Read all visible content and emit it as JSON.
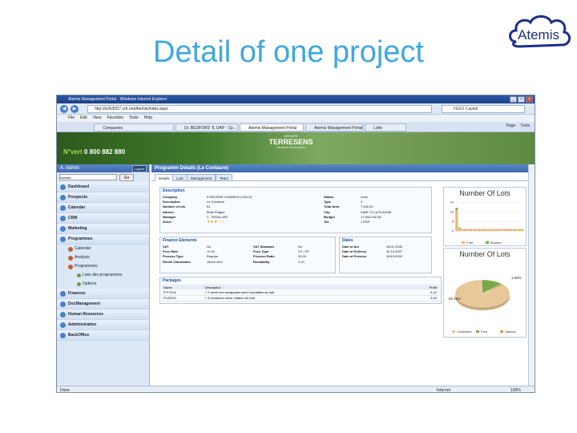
{
  "slide": {
    "title": "Detail of one project",
    "logo_text": "Atemis"
  },
  "browser": {
    "window_title": "Atemis Management Portal - Windows Internet Explorer",
    "url": "http://w2k3IIS7.rzh.net/Atemis/index.aspx",
    "search_placeholder": "FEED Capital",
    "menu": [
      "File",
      "Edit",
      "View",
      "Favorites",
      "Tools",
      "Help"
    ],
    "tabs": [
      "Companies",
      "Dr. BEDFORD 'IL DAP - Cp...",
      "Atemis Management Portal",
      "Atemis Management Portal",
      "Lotto"
    ],
    "toolbar": [
      "Page",
      "Tools"
    ],
    "status_left": "Done",
    "status_internet": "Internet",
    "zoom": "100%"
  },
  "banner": {
    "phone_prefix": "N°vert",
    "phone": "0 800 882 880",
    "brand_group": "GROUPE",
    "brand_name": "TERRESENS",
    "brand_sub": "Immobilier développeur"
  },
  "sidebar": {
    "user": "A. Admin",
    "logout": "Logout",
    "search_value": "nwnsss",
    "go": "Go",
    "items_top": [
      "Dashboard",
      "Prospects",
      "Calendar",
      "CRM",
      "Marketing",
      "Programmes"
    ],
    "sub": [
      "Calendar",
      "Analysis",
      "Programmes"
    ],
    "subsub": [
      "Liste des programmes",
      "Options"
    ],
    "items_bottom": [
      "Finances",
      "DocManagement",
      "Human Resources",
      "Administration",
      "BackOffice"
    ]
  },
  "main": {
    "title": "Programm Details (Le Contaure)",
    "tabs": [
      "Details",
      "Lots",
      "Management",
      "Team"
    ],
    "description": {
      "title": "Description",
      "left": [
        [
          "Company",
          "FONCIERE CHAMPOLLION 24"
        ],
        [
          "Description",
          "Le Contaure"
        ],
        [
          "Number of lots",
          "51"
        ],
        [
          "Adress",
          "Belle Plagne"
        ],
        [
          "Manager",
          "C. THIZILLIER"
        ],
        [
          "Score",
          ""
        ]
      ],
      "right": [
        [
          "Status",
          "Lens"
        ],
        [
          "Type",
          "3"
        ],
        [
          "Total Area",
          "7 626.00"
        ],
        [
          "City",
          "AIME 73 LA PLAGNE"
        ],
        [
          "Budget",
          "17 843 042.58"
        ],
        [
          "Tax",
          "1 RSP"
        ]
      ]
    },
    "finance": {
      "title": "Finance Elements",
      "c1": [
        [
          "VAT",
          "No"
        ],
        [
          "Fees Rate",
          "12.00"
        ],
        [
          "Process Type",
          "Regular"
        ],
        [
          "Rentis Calculation",
          "Jeune seul"
        ]
      ],
      "c2": [
        [
          "VAT Standard",
          "No"
        ],
        [
          "Fees Type",
          "HT / HT"
        ],
        [
          "Process Ratio",
          "30.00"
        ],
        [
          "Rentability",
          "4.10"
        ]
      ]
    },
    "dates": {
      "title": "Dates",
      "rows": [
        [
          "Date of Act",
          "28.01.2006"
        ],
        [
          "Date of Delivery",
          "30.12.2007"
        ],
        [
          "Date of Process",
          "30/12/2002"
        ]
      ]
    },
    "packages": {
      "title": "Packages",
      "headers": [
        "Name",
        "Description",
        "Profit"
      ],
      "rows": [
        [
          "ETI ECA",
          "+ 2 week end escapades selon modalités du bail",
          "4.10"
        ],
        [
          "PLASSO",
          "+ 5 semaines selon rotation du bail",
          "5.40"
        ]
      ]
    }
  },
  "chart_data": [
    {
      "type": "bar",
      "title": "Number Of Lots",
      "ylim": [
        0,
        15
      ],
      "yticks": [
        "15",
        "10",
        "5",
        "0"
      ],
      "series": [
        {
          "name": "Free",
          "color": "#e8b86a",
          "values": [
            11,
            2,
            1,
            1,
            1,
            1,
            1,
            1,
            1,
            1,
            1,
            1,
            1,
            1,
            1,
            1,
            1,
            1,
            1,
            1,
            1,
            1,
            1,
            1
          ]
        },
        {
          "name": "Booked",
          "color": "#7aa84a",
          "values": [
            1,
            0,
            0,
            0,
            0,
            0,
            0,
            0,
            0,
            0,
            0,
            0,
            0,
            0,
            0,
            0,
            0,
            0,
            0,
            0,
            0,
            0,
            0,
            0
          ]
        }
      ],
      "legend": [
        "Free",
        "Booked"
      ]
    },
    {
      "type": "pie",
      "title": "Number Of Lots",
      "slices": [
        {
          "label": "Confirmed",
          "value": 85.26,
          "color": "#e8c898"
        },
        {
          "label": "Free",
          "value": 13.06,
          "color": "#7aa84a"
        },
        {
          "label": "Options",
          "value": 1.68,
          "color": "#d89a4a"
        }
      ],
      "labels_shown": [
        "85.26%",
        "1.68%"
      ],
      "legend": [
        "Confirmed",
        "Free",
        "Options"
      ]
    }
  ]
}
